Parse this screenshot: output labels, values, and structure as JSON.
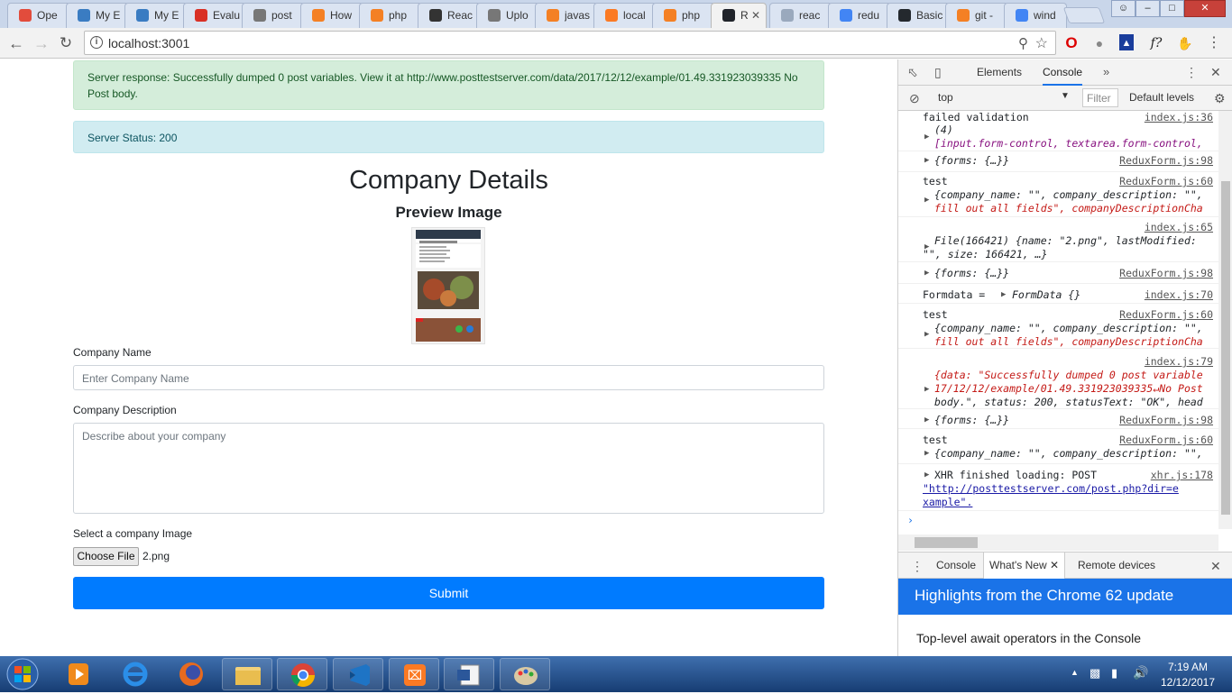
{
  "browser": {
    "tabs": [
      {
        "label": "Ope",
        "icon": "f-icon",
        "color": "#e24c3c"
      },
      {
        "label": "My E",
        "icon": "react-icon",
        "color": "#3a7cc2"
      },
      {
        "label": "My E",
        "icon": "react-icon",
        "color": "#3a7cc2"
      },
      {
        "label": "Evalu",
        "icon": "gmail-icon",
        "color": "#d93025"
      },
      {
        "label": "post",
        "icon": "doc-icon",
        "color": "#777"
      },
      {
        "label": "How",
        "icon": "stack-icon",
        "color": "#f48024"
      },
      {
        "label": "php",
        "icon": "stack-icon",
        "color": "#f48024"
      },
      {
        "label": "Reac",
        "icon": "cube-icon",
        "color": "#333"
      },
      {
        "label": "Uplo",
        "icon": "doc-icon",
        "color": "#777"
      },
      {
        "label": "javas",
        "icon": "stack-icon",
        "color": "#f48024"
      },
      {
        "label": "local",
        "icon": "xampp-icon",
        "color": "#fb7a24"
      },
      {
        "label": "php",
        "icon": "stack-icon",
        "color": "#f48024"
      },
      {
        "label": "R",
        "icon": "react-icon",
        "color": "#20232a",
        "active": true
      },
      {
        "label": "reac",
        "icon": "react-icon",
        "color": "#9aa9bd"
      },
      {
        "label": "redu",
        "icon": "docs-icon",
        "color": "#4285f4"
      },
      {
        "label": "Basic",
        "icon": "github-icon",
        "color": "#24292e"
      },
      {
        "label": "git -",
        "icon": "stack-icon",
        "color": "#f48024"
      },
      {
        "label": "wind",
        "icon": "google-icon",
        "color": "#4285f4"
      }
    ],
    "url": "localhost:3001"
  },
  "page": {
    "success_alert": "Server response: Successfully dumped 0 post variables. View it at http://www.posttestserver.com/data/2017/12/12/example/01.49.331923039335 No Post body.",
    "status_alert": "Server Status: 200",
    "title": "Company Details",
    "preview_heading": "Preview Image",
    "company_name_label": "Company Name",
    "company_name_placeholder": "Enter Company Name",
    "company_desc_label": "Company Description",
    "company_desc_placeholder": "Describe about your company",
    "image_label": "Select a company Image",
    "choose_file": "Choose File",
    "file_name": "2.png",
    "submit": "Submit"
  },
  "devtools": {
    "tabs": [
      "Elements",
      "Console"
    ],
    "active_tab": "Console",
    "context": "top",
    "filter_placeholder": "Filter",
    "levels": "Default levels",
    "drawer_tabs": [
      "Console",
      "What's New",
      "Remote devices"
    ],
    "whats_new_title": "Highlights from the Chrome 62 update",
    "whats_new_item": "Top-level await operators in the Console"
  },
  "console": {
    "e1_text": "failed validation",
    "e1_src": "index.js:36",
    "e1_count": "(4)",
    "e1_arr": "[input.form-control, textarea.form-control,",
    "e2_text": "{forms: {…}}",
    "e2_src": "ReduxForm.js:98",
    "e3_text": "test",
    "e3_src": "ReduxForm.js:60",
    "e3_obj_a": "{company_name: \"\", company_description: \"\",",
    "e3_obj_b": "fill out all fields\", companyDescriptionCha",
    "e4_src": "index.js:65",
    "e4_a": "File(166421) {name: \"2.png\", lastModified:",
    "e4_b": "\"\", size: 166421, …}",
    "e5_text": "{forms: {…}}",
    "e5_src": "ReduxForm.js:98",
    "e6_text": "Formdata =",
    "e6_obj": "FormData {}",
    "e6_src": "index.js:70",
    "e7_text": "test",
    "e7_src": "ReduxForm.js:60",
    "e7_obj_a": "{company_name: \"\", company_description: \"\",",
    "e7_obj_b": "fill out all fields\", companyDescriptionCha",
    "e8_src": "index.js:79",
    "e8_a": "{data: \"Successfully dumped 0 post variable",
    "e8_b": "17/12/12/example/01.49.331923039335↵No Post",
    "e8_c": "body.\", status: 200, statusText: \"OK\", head",
    "e9_text": "{forms: {…}}",
    "e9_src": "ReduxForm.js:98",
    "e10_text": "test",
    "e10_src": "ReduxForm.js:60",
    "e10_obj": "{company_name: \"\", company_description: \"\",",
    "e11_text": "XHR finished loading: POST",
    "e11_src": "xhr.js:178",
    "e11_url_a": "\"http://posttestserver.com/post.php?dir=e",
    "e11_url_b": "xample\"."
  },
  "taskbar": {
    "time": "7:19 AM",
    "date": "12/12/2017",
    "apps": [
      "media-player-icon",
      "ie-icon",
      "firefox-icon",
      "explorer-icon",
      "chrome-icon",
      "vscode-icon",
      "xampp-icon",
      "word-icon",
      "paint-icon"
    ]
  },
  "colors": {
    "primary": "#007bff",
    "success_bg": "#d4edda",
    "info_bg": "#d1ecf1",
    "taskbar": "#1f4b8a"
  }
}
